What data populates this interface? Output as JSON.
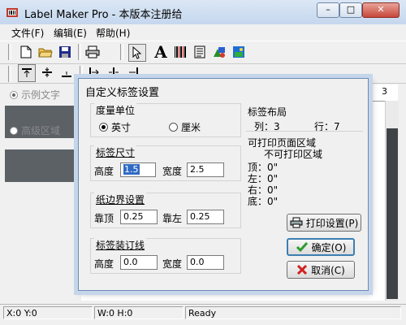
{
  "window": {
    "title": "Label Maker Pro - 本版本注册给",
    "minimize_glyph": "–",
    "maximize_glyph": "□",
    "close_glyph": "✕"
  },
  "menu": [
    "文件(F)",
    "编辑(E)",
    "帮助(H)"
  ],
  "toolbar": {
    "icons": [
      "new-file-icon",
      "open-folder-icon",
      "save-icon",
      "print-icon",
      "pointer-icon",
      "text-tool-icon",
      "barcode-icon",
      "document-icon",
      "shapes-icon",
      "image-icon"
    ],
    "text_tool_glyph": "A"
  },
  "left_panel": {
    "options": [
      {
        "label": "示例文字",
        "checked": true
      },
      {
        "label": "高级区域",
        "checked": false
      }
    ]
  },
  "ruler": {
    "mark": "3"
  },
  "status": {
    "coords": "X:0   Y:0",
    "size": "W:0  H:0",
    "state": "Ready"
  },
  "dialog": {
    "title": "自定义标签设置",
    "unit": {
      "title": "度量单位",
      "options": [
        {
          "label": "英寸",
          "checked": true
        },
        {
          "label": "厘米",
          "checked": false
        }
      ]
    },
    "label_size": {
      "title": "标签尺寸",
      "height_label": "高度",
      "height_value": "1.5",
      "width_label": "宽度",
      "width_value": "2.5"
    },
    "margins": {
      "title": "纸边界设置",
      "top_label": "靠顶",
      "top_value": "0.25",
      "left_label": "靠左",
      "left_value": "0.25"
    },
    "binding": {
      "title": "标签装订线",
      "height_label": "高度",
      "height_value": "0.0",
      "width_label": "宽度",
      "width_value": "0.0"
    },
    "layout": {
      "title": "标签布局",
      "columns": "列：3",
      "rows": "行：7"
    },
    "printable": {
      "title": "可打印页面区域",
      "subtitle": "不可打印区域",
      "top": "顶：0\"",
      "left": "左：0\"",
      "right": "右：0\"",
      "bottom": "底：0\""
    },
    "buttons": {
      "print_settings": "打印设置(P)",
      "ok": "确定(O)",
      "cancel": "取消(C)"
    }
  }
}
